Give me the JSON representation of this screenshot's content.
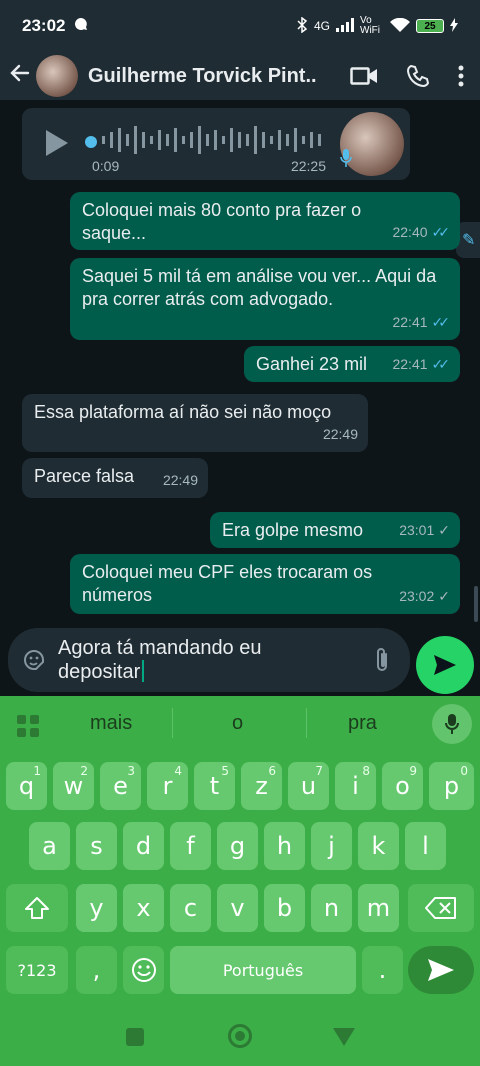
{
  "status_bar": {
    "time": "23:02",
    "network": "4G",
    "vowifi": "Vo WiFi",
    "battery": "25"
  },
  "header": {
    "contact_name": "Guilherme Torvick Pint..."
  },
  "voice_note": {
    "duration": "0:09",
    "time": "22:25"
  },
  "messages": [
    {
      "dir": "out",
      "text": "Coloquei mais 80 conto pra fazer o saque...",
      "time": "22:40",
      "status": "read"
    },
    {
      "dir": "out",
      "text": "Saquei 5 mil tá em análise vou ver... Aqui da pra correr atrás com advogado.",
      "time": "22:41",
      "status": "read"
    },
    {
      "dir": "out",
      "text": "Ganhei 23 mil",
      "time": "22:41",
      "status": "read"
    },
    {
      "dir": "in",
      "text": "Essa plataforma aí não sei não moço",
      "time": "22:49"
    },
    {
      "dir": "in",
      "text": "Parece falsa",
      "time": "22:49"
    },
    {
      "dir": "out",
      "text": "Era golpe mesmo",
      "time": "23:01",
      "status": "sent"
    },
    {
      "dir": "out",
      "text": "Coloquei meu CPF eles trocaram os números",
      "time": "23:02",
      "status": "sent"
    }
  ],
  "composer": {
    "line1": "Agora tá mandando eu",
    "line2": "depositar"
  },
  "keyboard": {
    "suggestions": [
      "mais",
      "o",
      "pra"
    ],
    "row1": [
      [
        "q",
        "1"
      ],
      [
        "w",
        "2"
      ],
      [
        "e",
        "3"
      ],
      [
        "r",
        "4"
      ],
      [
        "t",
        "5"
      ],
      [
        "z",
        "6"
      ],
      [
        "u",
        "7"
      ],
      [
        "i",
        "8"
      ],
      [
        "o",
        "9"
      ],
      [
        "p",
        "0"
      ]
    ],
    "row2": [
      "a",
      "s",
      "d",
      "f",
      "g",
      "h",
      "j",
      "k",
      "l"
    ],
    "row3": [
      "y",
      "x",
      "c",
      "v",
      "b",
      "n",
      "m"
    ],
    "symbols_key": "?123",
    "comma_key": ",",
    "space_label": "Português",
    "period_key": "."
  },
  "colors": {
    "outgoing": "#005c4b",
    "incoming": "#1f2c33",
    "accent": "#25d366",
    "keyboard": "#3cae47"
  }
}
